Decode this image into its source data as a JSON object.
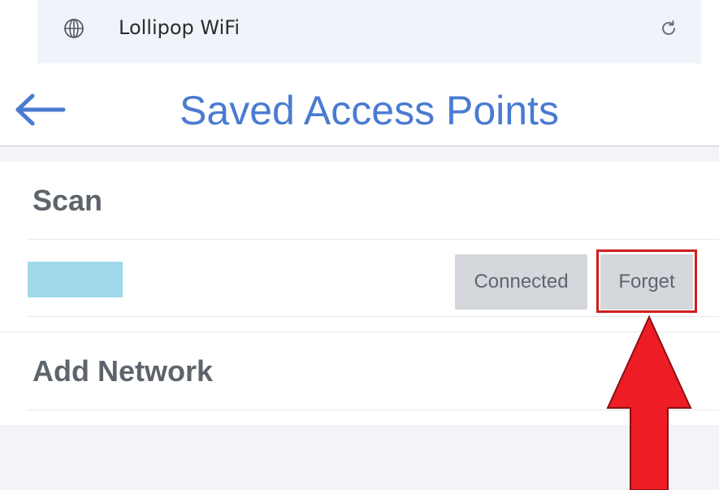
{
  "browser": {
    "title": "Lollipop WiFi",
    "globe_icon": "globe-icon",
    "reload_icon": "reload-icon"
  },
  "header": {
    "back_icon": "arrow-left-icon",
    "title": "Saved Access Points",
    "accent_color": "#4a7bd0"
  },
  "sections": {
    "scan_label": "Scan",
    "add_network_label": "Add Network"
  },
  "saved_network": {
    "name": "",
    "connected_label": "Connected",
    "forget_label": "Forget"
  },
  "annotation": {
    "highlight_color": "#d11e1e",
    "arrow_color": "#ee1c25",
    "target": "Forget"
  }
}
